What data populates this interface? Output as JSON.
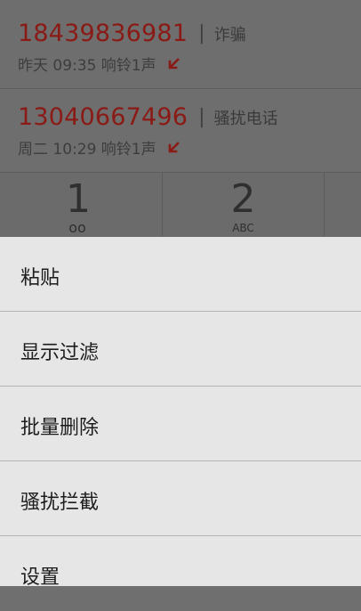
{
  "call_log": [
    {
      "number": "18439836981",
      "tag": "诈骗",
      "time": "昨天 09:35 响铃1声",
      "status": "missed"
    },
    {
      "number": "13040667496",
      "tag": "骚扰电话",
      "time": "周二 10:29 响铃1声",
      "status": "missed"
    }
  ],
  "keypad": {
    "key1": {
      "digit": "1",
      "sub": "oo"
    },
    "key2": {
      "digit": "2",
      "sub": "ABC"
    }
  },
  "menu": {
    "items": [
      {
        "label": "粘贴"
      },
      {
        "label": "显示过滤"
      },
      {
        "label": "批量删除"
      },
      {
        "label": "骚扰拦截"
      },
      {
        "label": "设置"
      }
    ]
  },
  "colors": {
    "number": "#8a1a15",
    "menu_bg": "#e6e6e6",
    "overlay_bg": "#6e6e6e"
  }
}
